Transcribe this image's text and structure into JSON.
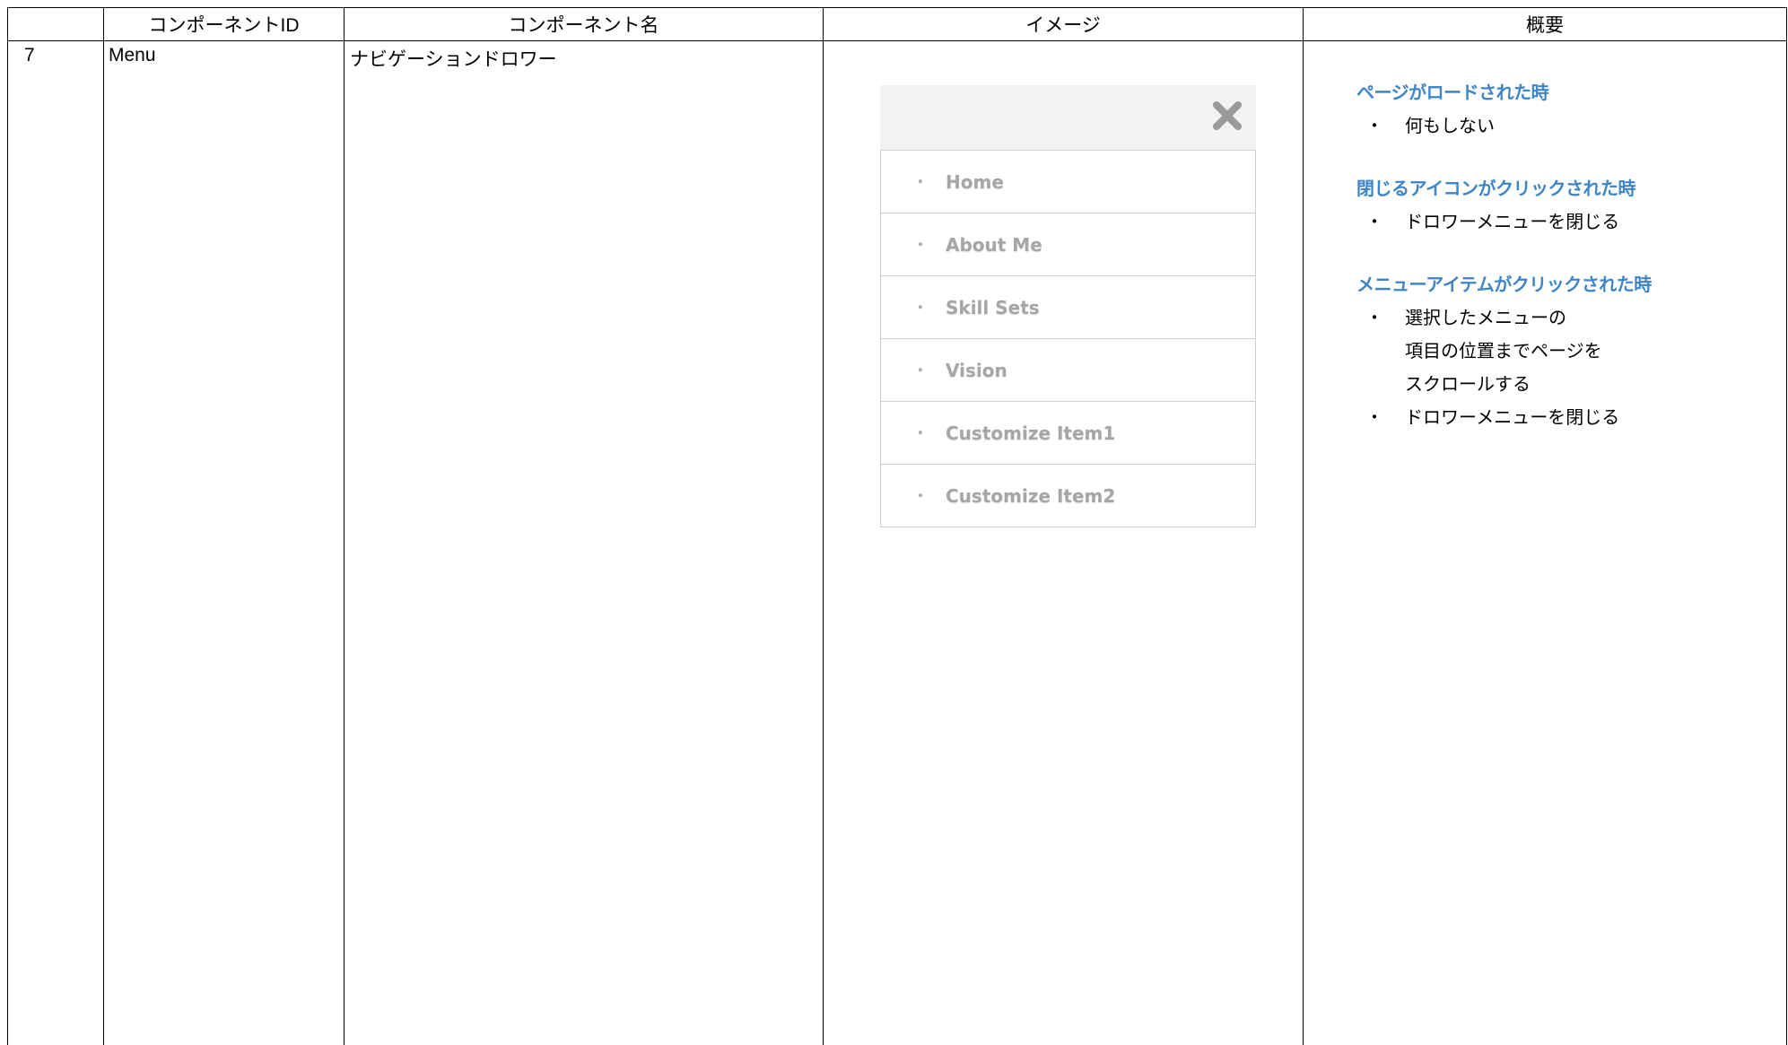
{
  "table": {
    "headers": [
      "",
      "コンポーネントID",
      "コンポーネント名",
      "イメージ",
      "概要"
    ],
    "row": {
      "no": "7",
      "component_id": "Menu",
      "component_name": "ナビゲーションドロワー"
    }
  },
  "drawer": {
    "close_icon": "close-x-icon",
    "items": [
      "Home",
      "About Me",
      "Skill Sets",
      "Vision",
      "Customize Item1",
      "Customize Item2"
    ]
  },
  "overview": {
    "sections": [
      {
        "heading": "ページがロードされた時",
        "items": [
          "何もしない"
        ]
      },
      {
        "heading": "閉じるアイコンがクリックされた時",
        "items": [
          "ドロワーメニューを閉じる"
        ]
      },
      {
        "heading": "メニューアイテムがクリックされた時",
        "items": [
          "選択したメニューの\n項目の位置までページを\nスクロールする",
          "ドロワーメニューを閉じる"
        ]
      }
    ]
  },
  "colors": {
    "heading_blue": "#3d85c6",
    "drawer_text": "#a6a6a6",
    "drawer_header_bg": "#f2f2f2"
  }
}
